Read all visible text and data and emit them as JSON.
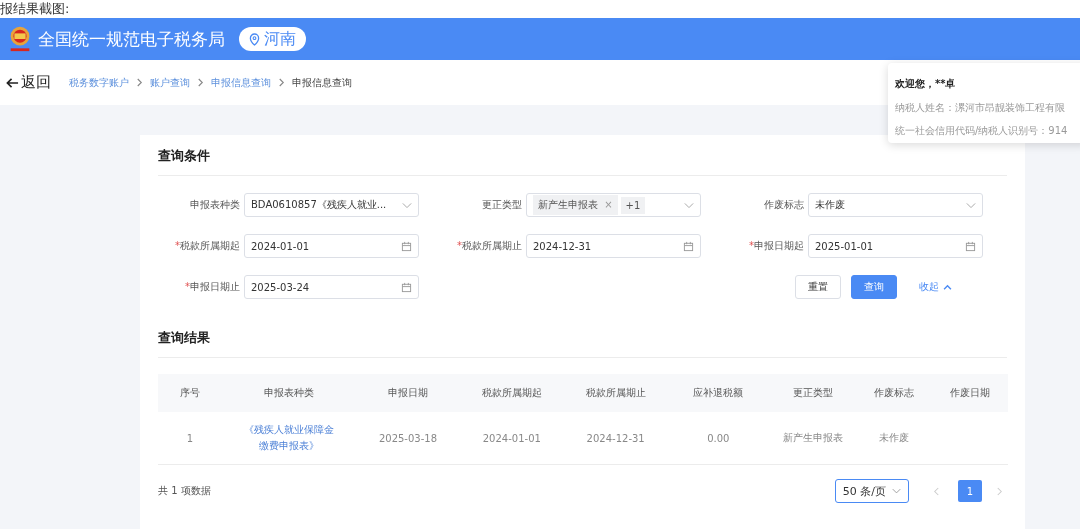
{
  "caption": "报结果截图:",
  "header": {
    "title": "全国统一规范电子税务局",
    "region": "河南"
  },
  "nav": {
    "back": "返回",
    "breadcrumbs": [
      {
        "label": "税务数字账户",
        "current": false
      },
      {
        "label": "账户查询",
        "current": false
      },
      {
        "label": "申报信息查询",
        "current": false
      },
      {
        "label": "申报信息查询",
        "current": true
      }
    ]
  },
  "user_popup": {
    "greeting": "欢迎您，**卓",
    "lines": [
      "纳税人姓名：漯河市昂靓装饰工程有限",
      "统一社会信用代码/纳税人识别号：914"
    ]
  },
  "query": {
    "title": "查询条件",
    "fields": [
      {
        "label": "申报表种类",
        "kind": "select",
        "value": "BDA0610857《残疾人就业..."
      },
      {
        "label": "更正类型",
        "kind": "tags",
        "tags": [
          {
            "text": "新产生申报表",
            "remove": "×"
          }
        ],
        "more": "+1"
      },
      {
        "label": "作废标志",
        "kind": "select",
        "value": "未作废"
      },
      {
        "label": "税款所属期起",
        "kind": "date",
        "required_mark": "*",
        "value": "2024-01-01"
      },
      {
        "label": "税款所属期止",
        "kind": "date",
        "required_mark": "*",
        "value": "2024-12-31"
      },
      {
        "label": "申报日期起",
        "kind": "date",
        "required_mark": "*",
        "value": "2025-01-01"
      },
      {
        "label": "申报日期止",
        "kind": "date",
        "required_mark": "*",
        "value": "2025-03-24"
      }
    ],
    "buttons": [
      {
        "label": "重置",
        "kind": "default"
      },
      {
        "label": "查询",
        "kind": "primary"
      }
    ],
    "collapse": "收起"
  },
  "results": {
    "title": "查询结果",
    "columns": [
      "序号",
      "申报表种类",
      "申报日期",
      "税款所属期起",
      "税款所属期止",
      "应补退税额",
      "更正类型",
      "作废标志",
      "作废日期"
    ],
    "rows": [
      [
        "1",
        "《残疾人就业保障金缴费申报表》",
        "2025-03-18",
        "2024-01-01",
        "2024-12-31",
        "0.00",
        "新产生申报表",
        "未作废",
        ""
      ]
    ],
    "total": "共 1 项数据",
    "page_size": "50 条/页",
    "pages": [
      {
        "label": "1",
        "selected": true
      }
    ]
  }
}
